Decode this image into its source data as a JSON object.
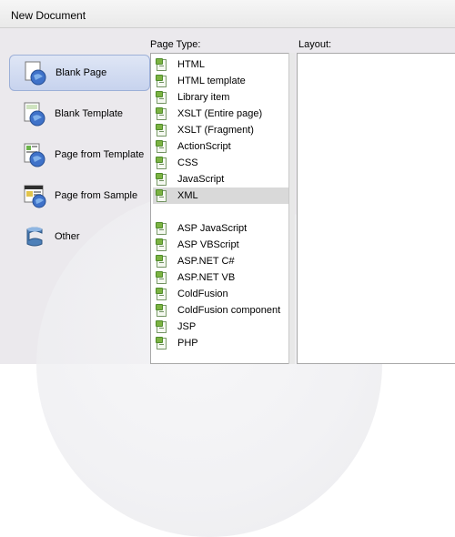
{
  "dialog": {
    "title": "New Document",
    "page_type_label": "Page Type:",
    "layout_label": "Layout:"
  },
  "categories": [
    {
      "label": "Blank Page",
      "icon": "blank-page-icon",
      "selected": true
    },
    {
      "label": "Blank Template",
      "icon": "blank-template-icon",
      "selected": false
    },
    {
      "label": "Page from Template",
      "icon": "page-from-template-icon",
      "selected": false
    },
    {
      "label": "Page from Sample",
      "icon": "page-from-sample-icon",
      "selected": false
    },
    {
      "label": "Other",
      "icon": "other-icon",
      "selected": false
    }
  ],
  "page_types": [
    {
      "label": "HTML"
    },
    {
      "label": "HTML template"
    },
    {
      "label": "Library item"
    },
    {
      "label": "XSLT (Entire page)"
    },
    {
      "label": "XSLT (Fragment)"
    },
    {
      "label": "ActionScript"
    },
    {
      "label": "CSS"
    },
    {
      "label": "JavaScript"
    },
    {
      "label": "XML",
      "selected": true
    },
    {
      "label": "ASP JavaScript"
    },
    {
      "label": "ASP VBScript"
    },
    {
      "label": "ASP.NET C#"
    },
    {
      "label": "ASP.NET VB"
    },
    {
      "label": "ColdFusion"
    },
    {
      "label": "ColdFusion component"
    },
    {
      "label": "JSP"
    },
    {
      "label": "PHP"
    }
  ],
  "colors": {
    "dialog_bg": "#ebe9ed",
    "selected_category": "#c7d3ee",
    "selected_row": "#d9d9d9"
  }
}
